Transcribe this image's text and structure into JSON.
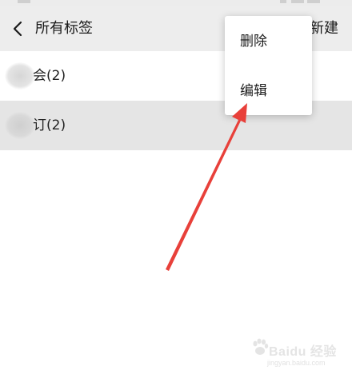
{
  "header": {
    "title": "所有标签",
    "new_label": "新建"
  },
  "tags": [
    {
      "label": "会(2)"
    },
    {
      "label": "订(2)"
    }
  ],
  "context_menu": {
    "items": [
      {
        "label": "删除"
      },
      {
        "label": "编辑"
      }
    ]
  },
  "annotation": {
    "arrow_color": "#e8403a"
  },
  "watermark": {
    "brand": "Baidu 经验",
    "url": "jingyan.baidu.com"
  }
}
